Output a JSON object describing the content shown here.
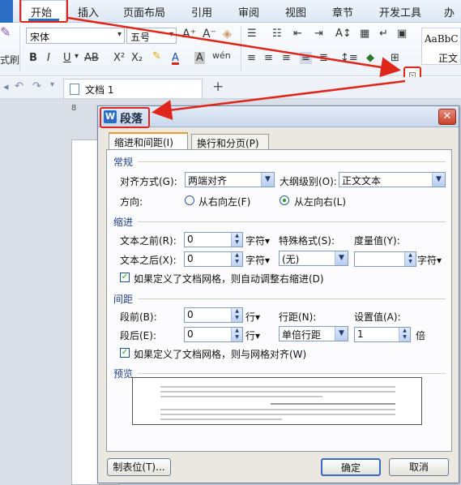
{
  "menubar": {
    "items": [
      "开始",
      "插入",
      "页面布局",
      "引用",
      "审阅",
      "视图",
      "章节",
      "开发工具",
      "办公"
    ],
    "active": "开始"
  },
  "ribbon": {
    "font_name": "宋体",
    "font_size": "五号",
    "format_painter_label": "式刷",
    "style_preview": "AaBbC",
    "style_name": "正文"
  },
  "tabs": {
    "doc_title": "文档 1",
    "new_tab": "+"
  },
  "ruler": {
    "mark": "8"
  },
  "dialog": {
    "title": "段落",
    "close": "✕",
    "tabs": [
      "缩进和间距(I)",
      "换行和分页(P)"
    ],
    "general": {
      "section": "常规",
      "align_label": "对齐方式(G):",
      "align_value": "两端对齐",
      "outline_label": "大纲级别(O):",
      "outline_value": "正文文本",
      "direction_label": "方向:",
      "rtl_label": "从右向左(F)",
      "ltr_label": "从左向右(L)"
    },
    "indent": {
      "section": "缩进",
      "before_label": "文本之前(R):",
      "before_value": "0",
      "before_unit": "字符▾",
      "special_label": "特殊格式(S):",
      "metric_label": "度量值(Y):",
      "after_label": "文本之后(X):",
      "after_value": "0",
      "after_unit": "字符▾",
      "special_value": "(无)",
      "metric_value": "",
      "metric_unit": "字符▾",
      "auto_adjust": "如果定义了文档网格，则自动调整右缩进(D)"
    },
    "spacing": {
      "section": "间距",
      "before_label": "段前(B):",
      "before_value": "0",
      "before_unit": "行▾",
      "line_label": "行距(N):",
      "setting_label": "设置值(A):",
      "after_label": "段后(E):",
      "after_value": "0",
      "after_unit": "行▾",
      "line_value": "单倍行距",
      "setting_value": "1",
      "setting_unit": "倍",
      "snap_grid": "如果定义了文档网格，则与网格对齐(W)"
    },
    "preview": {
      "section": "预览"
    },
    "buttons": {
      "tabs": "制表位(T)...",
      "ok": "确定",
      "cancel": "取消"
    }
  },
  "colors": {
    "annotation": "#e0261a",
    "accent": "#2b6cc4"
  }
}
